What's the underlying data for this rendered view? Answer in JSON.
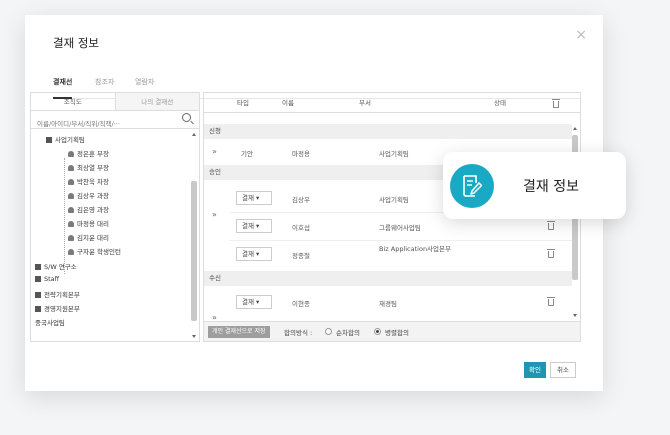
{
  "dialog": {
    "title": "결재 정보",
    "close": "×",
    "tabs": [
      {
        "label": "결재선",
        "active": true
      },
      {
        "label": "참조자",
        "active": false
      },
      {
        "label": "열람자",
        "active": false
      }
    ]
  },
  "left_panel": {
    "tabs": [
      "조직도",
      "나의 결재선"
    ],
    "search_placeholder": "이름/아이디/부서/직위/직책/···",
    "tree": [
      {
        "label": "사업기획팀",
        "type": "dept"
      },
      {
        "label": "정은훈 부장",
        "type": "person"
      },
      {
        "label": "최상열 부장",
        "type": "person"
      },
      {
        "label": "박찬욱 차장",
        "type": "person"
      },
      {
        "label": "김상우 과장",
        "type": "person"
      },
      {
        "label": "김은영 과장",
        "type": "person"
      },
      {
        "label": "마정용 대리",
        "type": "person"
      },
      {
        "label": "김지윤 대리",
        "type": "person"
      },
      {
        "label": "구자윤 학생인턴",
        "type": "person"
      },
      {
        "label": "S/W 연구소",
        "type": "dept"
      },
      {
        "label": "Staff",
        "type": "dept"
      },
      {
        "label": "전략기획본부",
        "type": "dept"
      },
      {
        "label": "경영지원본부",
        "type": "dept"
      },
      {
        "label": "중국사업팀",
        "type": "dept"
      }
    ]
  },
  "right_panel": {
    "headers": [
      "타입",
      "이름",
      "부서",
      "상태"
    ],
    "sections": {
      "request": "신청",
      "approval": "승인",
      "receive": "수신"
    },
    "request_row": {
      "type": "기안",
      "name": "마정용",
      "dept": "사업기획팀"
    },
    "approval_rows": [
      {
        "type": "결재 ▾",
        "name": "김상우",
        "dept": "사업기획팀"
      },
      {
        "type": "결재 ▾",
        "name": "이호섭",
        "dept": "그룹웨어사업팀"
      },
      {
        "type": "결재 ▾",
        "name": "정종철",
        "dept": "Biz Application사업본부"
      }
    ],
    "receive_rows": [
      {
        "type": "결재 ▾",
        "name": "이현종",
        "dept": "재경팀"
      }
    ],
    "footer": {
      "save_label": "개인 결재선으로 저장",
      "mode_label": "합의방식 :",
      "options": [
        "순차합의",
        "병렬합의"
      ],
      "selected": "병렬합의"
    }
  },
  "buttons": {
    "ok": "확인",
    "cancel": "취소"
  },
  "badge": {
    "text": "결재 정보",
    "icon": "document-edit-icon",
    "color": "#1aa9c4"
  }
}
